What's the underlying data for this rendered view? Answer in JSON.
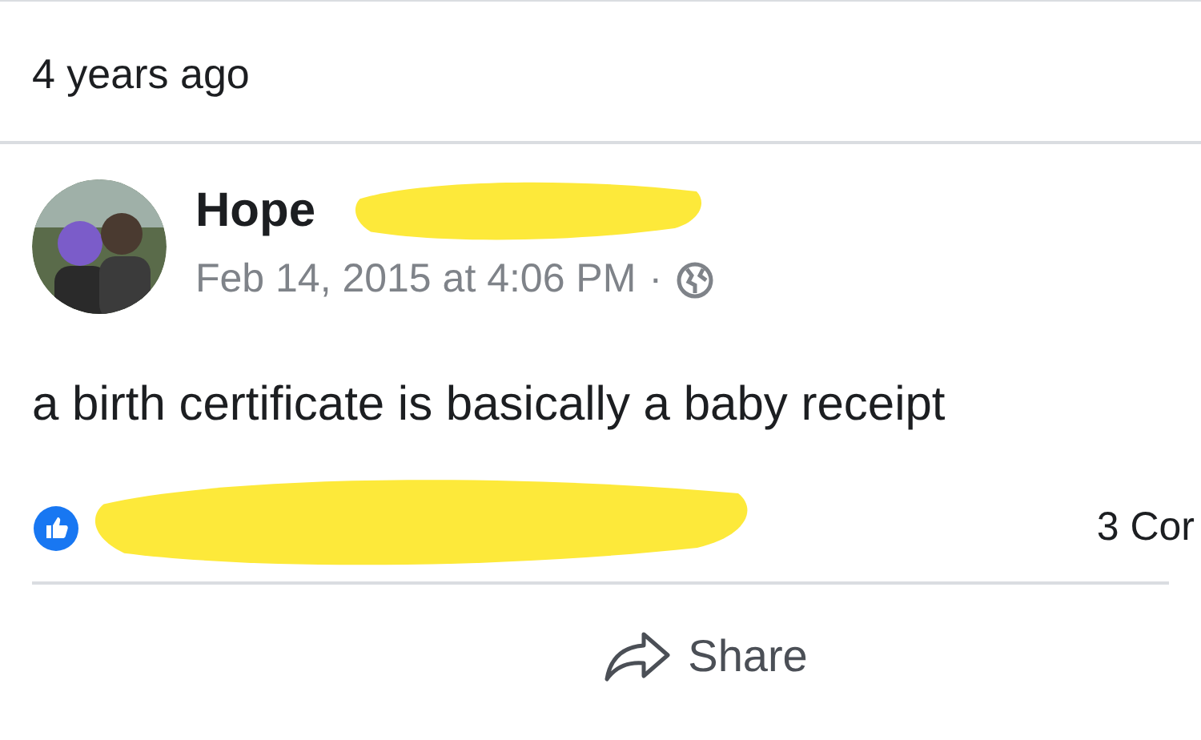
{
  "header": {
    "time": "4 years ago"
  },
  "post": {
    "author": "Hope",
    "date": "Feb 14, 2015 at 4:06 PM",
    "separator": "·",
    "redacted_name": true,
    "text": "a birth certificate is basically a baby receipt"
  },
  "reactions": {
    "redacted_names": true,
    "comments": "3 Cor"
  },
  "actions": [
    {
      "label": "Share"
    }
  ]
}
